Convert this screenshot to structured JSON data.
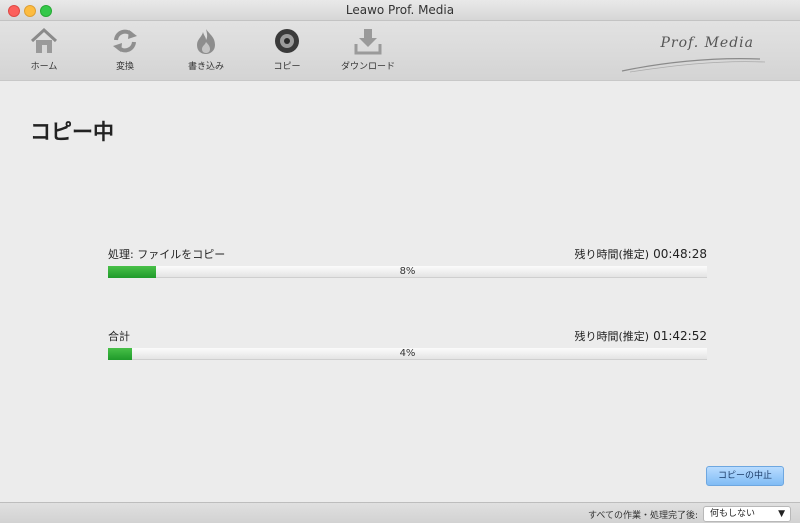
{
  "window": {
    "title": "Leawo Prof. Media"
  },
  "toolbar": {
    "items": [
      {
        "label": "ホーム",
        "icon": "home-icon"
      },
      {
        "label": "変換",
        "icon": "convert-icon"
      },
      {
        "label": "書き込み",
        "icon": "burn-icon"
      },
      {
        "label": "コピー",
        "icon": "copy-disc-icon"
      },
      {
        "label": "ダウンロード",
        "icon": "download-icon"
      }
    ],
    "logo_text": "Prof. Media"
  },
  "main": {
    "title": "コピー中",
    "current": {
      "label": "処理: ファイルをコピー",
      "remaining_label": "残り時間(推定)",
      "remaining_time": "00:48:28",
      "percent_text": "8%",
      "progress": 0.08
    },
    "total": {
      "label": "合計",
      "remaining_label": "残り時間(推定)",
      "remaining_time": "01:42:52",
      "percent_text": "4%",
      "progress": 0.04
    },
    "stop_button": "コピーの中止"
  },
  "statusbar": {
    "after_label": "すべての作業・処理完了後:",
    "after_value": "何もしない"
  },
  "colors": {
    "progress": "#2eab36",
    "accent_button": "#8cc4f7"
  }
}
